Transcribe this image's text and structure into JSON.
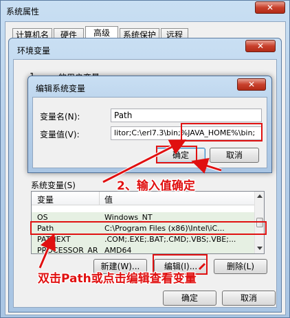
{
  "sysprops": {
    "title": "系统属性",
    "close": "✕",
    "tabs": [
      "计算机名",
      "硬件",
      "高级",
      "系统保护",
      "远程"
    ]
  },
  "envvars": {
    "title": "环境变量",
    "close": "✕",
    "user_section_label": "的用户变量",
    "user_section_prefix": "1",
    "system_section_label": "系统变量(S)",
    "headers": {
      "variable": "变量",
      "value": "值"
    },
    "rows": [
      {
        "variable": "OS",
        "value": "Windows_NT"
      },
      {
        "variable": "Path",
        "value": "C:\\Program Files (x86)\\Intel\\iC..."
      },
      {
        "variable": "PATHEXT",
        "value": ".COM;.EXE;.BAT;.CMD;.VBS;.VBE;..."
      },
      {
        "variable": "PROCESSOR_AR",
        "value": "AMD64"
      }
    ],
    "buttons": {
      "new": "新建(W)...",
      "edit": "编辑(I)...",
      "delete": "删除(L)"
    },
    "ok": "确定",
    "cancel": "取消"
  },
  "editdlg": {
    "title": "编辑系统变量",
    "close": "✕",
    "name_label": "变量名(N):",
    "value_label": "变量值(V):",
    "name_value": "Path",
    "value_value": "litor;C:\\erl7.3\\bin;%JAVA_HOME%\\bin;",
    "ok": "确定",
    "cancel": "取消"
  },
  "annotations": {
    "step2": "2、输入值确定",
    "step1": "双击Path或点击编辑查看变量",
    "color": "#e01010"
  }
}
